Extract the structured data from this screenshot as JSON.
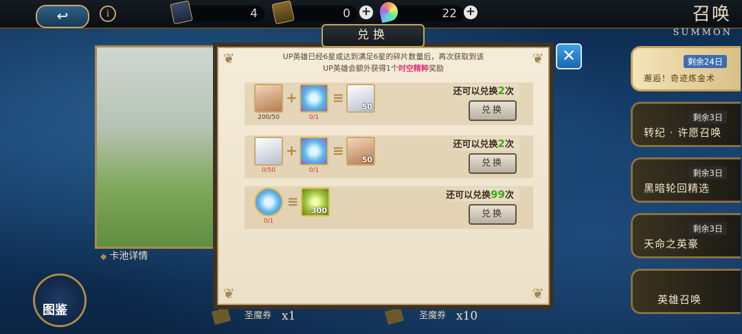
{
  "topbar": {
    "back_icon": "↩",
    "info_icon": "i",
    "resources": [
      {
        "name": "summon-ticket",
        "value": "4"
      },
      {
        "name": "gold-ticket",
        "value": "0"
      },
      {
        "name": "rainbow-crystal",
        "value": "22"
      }
    ],
    "plus": "+",
    "title": "召唤",
    "subtitle": "SUMMON"
  },
  "banner": {
    "detail_label": "卡池详情",
    "atlas_label": "图鉴"
  },
  "tickets": [
    {
      "label": "圣魔券",
      "count": "x1"
    },
    {
      "label": "圣魔券",
      "count": "x10"
    }
  ],
  "tabs": [
    {
      "days": "剩余24日",
      "label": "邂逅！奇迹炼金术",
      "active": true
    },
    {
      "days": "剩余3日",
      "label": "转纪 · 许愿召唤",
      "active": false
    },
    {
      "days": "剩余3日",
      "label": "黑暗轮回精选",
      "active": false
    },
    {
      "days": "剩余3日",
      "label": "天命之英豪",
      "active": false
    },
    {
      "days": "",
      "label": "英雄召唤",
      "active": false
    }
  ],
  "modal": {
    "title": "兑换",
    "close_icon": "✕",
    "desc_line1": "UP英雄已经6星或达到满足6星的碎片数量后，再次获取到该",
    "desc_line2_pre": "UP英雄会额外获得",
    "desc_line2_num": "1个",
    "desc_line2_hl": "时空精粹",
    "desc_line2_post": "奖励",
    "rows": [
      {
        "in1_count": "200/50",
        "in2_count": "0/1",
        "out_qty": "50",
        "remain_pre": "还可以兑换",
        "remain_num": "2",
        "remain_post": "次",
        "button": "兑换"
      },
      {
        "in1_count": "0/50",
        "in2_count": "0/1",
        "out_qty": "50",
        "remain_pre": "还可以兑换",
        "remain_num": "2",
        "remain_post": "次",
        "button": "兑换"
      },
      {
        "in1_count": "0/1",
        "out_qty": "300",
        "remain_pre": "还可以兑换",
        "remain_num": "99",
        "remain_post": "次",
        "button": "兑换"
      }
    ]
  },
  "colors": {
    "accent_gold": "#c9a96a",
    "highlight_pink": "#e0387a",
    "remain_green": "#3fa818",
    "close_blue": "#2a86cc"
  }
}
